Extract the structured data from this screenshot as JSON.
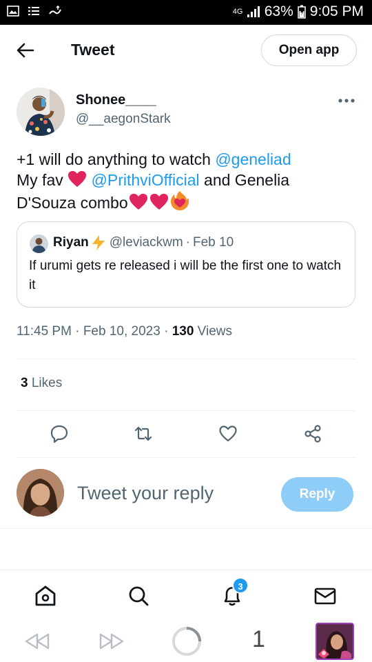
{
  "status_bar": {
    "network": "4G",
    "battery": "63%",
    "time": "9:05 PM"
  },
  "header": {
    "title": "Tweet",
    "open_app_label": "Open app"
  },
  "tweet": {
    "author_name": "Shonee____",
    "author_handle": "@__aegonStark",
    "text": {
      "line1_prefix": "+1 will do  anything to watch ",
      "mention1": "@geneliad",
      "line2_prefix": "My fav ",
      "mention2": "@PrithviOfficial",
      "line2_suffix": " and Genelia",
      "line3": "D'Souza combo"
    },
    "quote": {
      "name": "Riyan",
      "handle": "@leviackwm",
      "date": "Feb 10",
      "text": "If urumi gets re released i will be the first one to watch it"
    },
    "time": "11:45 PM",
    "date": "Feb 10, 2023",
    "views_count": "130",
    "views_label": "Views",
    "likes_count": "3",
    "likes_label": "Likes"
  },
  "reply": {
    "placeholder": "Tweet your reply",
    "button_label": "Reply"
  },
  "bottom_nav": {
    "notifications_badge": "3"
  },
  "browser": {
    "tab_count": "1"
  },
  "colors": {
    "accent": "#1d9bf0",
    "reply_button": "#8ecdf8",
    "heart": "#e0245e"
  }
}
